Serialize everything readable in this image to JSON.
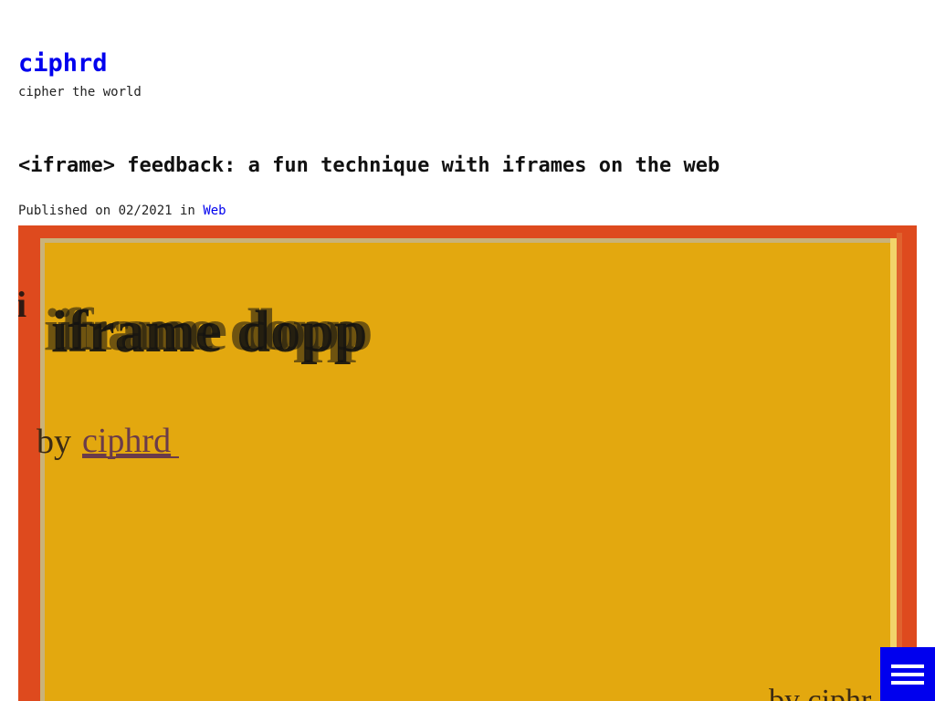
{
  "site": {
    "title": "ciphrd",
    "tagline": "cipher the world"
  },
  "post": {
    "title": "<iframe> feedback: a fun technique with iframes on the web",
    "meta_prefix": "Published on 02/2021 in",
    "category": "Web"
  },
  "hero": {
    "title_text": "iframe dopp",
    "by_label": "by",
    "author_link": "ciphrd",
    "corner_fragment": "by ciphr",
    "colors": {
      "outer": "#de4a1e",
      "inner": "#e0a510"
    }
  },
  "menu": {
    "icon": "hamburger-menu-icon",
    "color": "#0000ee"
  }
}
